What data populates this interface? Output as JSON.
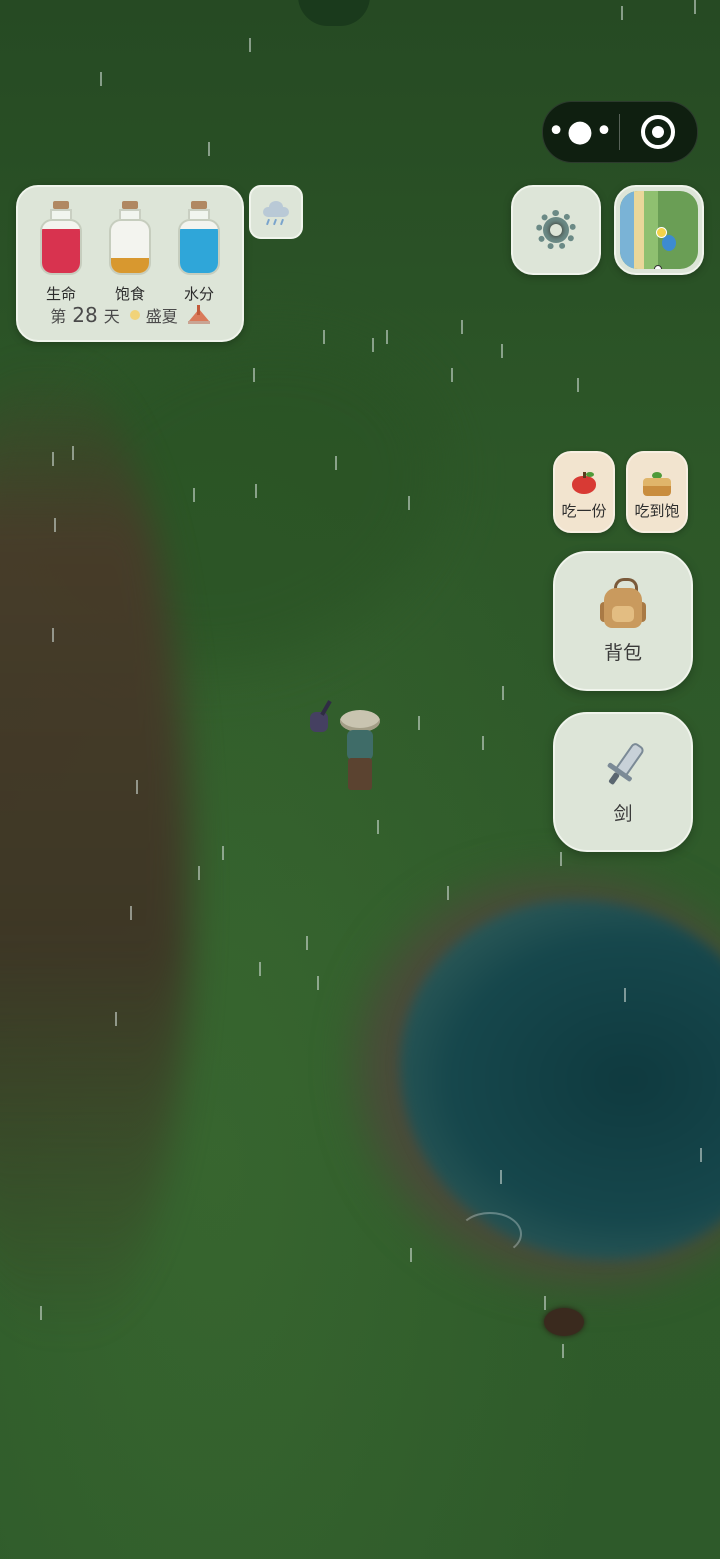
{
  "top_capsule": {
    "more_glyph": "•●•"
  },
  "status_panel": {
    "meters": [
      {
        "label": "生命",
        "color": "#d8334f",
        "level": 0.85
      },
      {
        "label": "饱食",
        "color": "#d8982f",
        "level": 0.28
      },
      {
        "label": "水分",
        "color": "#2fa6d9",
        "level": 0.85
      }
    ],
    "day_prefix": "第",
    "day_number": "28",
    "day_suffix": "天",
    "season": "盛夏"
  },
  "weather": {
    "icon": "rain-cloud-icon"
  },
  "settings": {
    "icon": "gear-icon"
  },
  "minimap": {
    "icon": "minimap-icon"
  },
  "actions": {
    "eat_one": {
      "label": "吃一份",
      "icon": "apple-icon"
    },
    "eat_full": {
      "label": "吃到饱",
      "icon": "lunchbox-icon"
    },
    "backpack": {
      "label": "背包",
      "icon": "backpack-icon"
    },
    "weapon": {
      "label": "剑",
      "icon": "sword-icon"
    }
  }
}
